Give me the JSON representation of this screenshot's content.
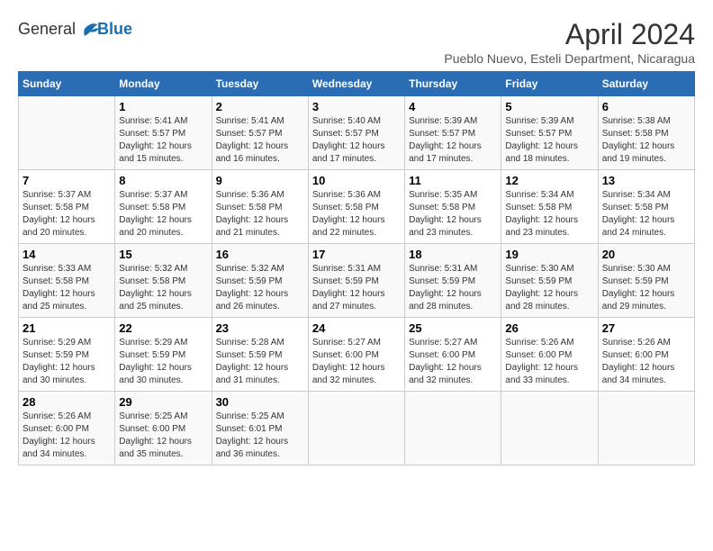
{
  "logo": {
    "text_general": "General",
    "text_blue": "Blue"
  },
  "title": "April 2024",
  "subtitle": "Pueblo Nuevo, Esteli Department, Nicaragua",
  "days_of_week": [
    "Sunday",
    "Monday",
    "Tuesday",
    "Wednesday",
    "Thursday",
    "Friday",
    "Saturday"
  ],
  "weeks": [
    [
      {
        "day": "",
        "info": ""
      },
      {
        "day": "1",
        "info": "Sunrise: 5:41 AM\nSunset: 5:57 PM\nDaylight: 12 hours\nand 15 minutes."
      },
      {
        "day": "2",
        "info": "Sunrise: 5:41 AM\nSunset: 5:57 PM\nDaylight: 12 hours\nand 16 minutes."
      },
      {
        "day": "3",
        "info": "Sunrise: 5:40 AM\nSunset: 5:57 PM\nDaylight: 12 hours\nand 17 minutes."
      },
      {
        "day": "4",
        "info": "Sunrise: 5:39 AM\nSunset: 5:57 PM\nDaylight: 12 hours\nand 17 minutes."
      },
      {
        "day": "5",
        "info": "Sunrise: 5:39 AM\nSunset: 5:57 PM\nDaylight: 12 hours\nand 18 minutes."
      },
      {
        "day": "6",
        "info": "Sunrise: 5:38 AM\nSunset: 5:58 PM\nDaylight: 12 hours\nand 19 minutes."
      }
    ],
    [
      {
        "day": "7",
        "info": "Sunrise: 5:37 AM\nSunset: 5:58 PM\nDaylight: 12 hours\nand 20 minutes."
      },
      {
        "day": "8",
        "info": "Sunrise: 5:37 AM\nSunset: 5:58 PM\nDaylight: 12 hours\nand 20 minutes."
      },
      {
        "day": "9",
        "info": "Sunrise: 5:36 AM\nSunset: 5:58 PM\nDaylight: 12 hours\nand 21 minutes."
      },
      {
        "day": "10",
        "info": "Sunrise: 5:36 AM\nSunset: 5:58 PM\nDaylight: 12 hours\nand 22 minutes."
      },
      {
        "day": "11",
        "info": "Sunrise: 5:35 AM\nSunset: 5:58 PM\nDaylight: 12 hours\nand 23 minutes."
      },
      {
        "day": "12",
        "info": "Sunrise: 5:34 AM\nSunset: 5:58 PM\nDaylight: 12 hours\nand 23 minutes."
      },
      {
        "day": "13",
        "info": "Sunrise: 5:34 AM\nSunset: 5:58 PM\nDaylight: 12 hours\nand 24 minutes."
      }
    ],
    [
      {
        "day": "14",
        "info": "Sunrise: 5:33 AM\nSunset: 5:58 PM\nDaylight: 12 hours\nand 25 minutes."
      },
      {
        "day": "15",
        "info": "Sunrise: 5:32 AM\nSunset: 5:58 PM\nDaylight: 12 hours\nand 25 minutes."
      },
      {
        "day": "16",
        "info": "Sunrise: 5:32 AM\nSunset: 5:59 PM\nDaylight: 12 hours\nand 26 minutes."
      },
      {
        "day": "17",
        "info": "Sunrise: 5:31 AM\nSunset: 5:59 PM\nDaylight: 12 hours\nand 27 minutes."
      },
      {
        "day": "18",
        "info": "Sunrise: 5:31 AM\nSunset: 5:59 PM\nDaylight: 12 hours\nand 28 minutes."
      },
      {
        "day": "19",
        "info": "Sunrise: 5:30 AM\nSunset: 5:59 PM\nDaylight: 12 hours\nand 28 minutes."
      },
      {
        "day": "20",
        "info": "Sunrise: 5:30 AM\nSunset: 5:59 PM\nDaylight: 12 hours\nand 29 minutes."
      }
    ],
    [
      {
        "day": "21",
        "info": "Sunrise: 5:29 AM\nSunset: 5:59 PM\nDaylight: 12 hours\nand 30 minutes."
      },
      {
        "day": "22",
        "info": "Sunrise: 5:29 AM\nSunset: 5:59 PM\nDaylight: 12 hours\nand 30 minutes."
      },
      {
        "day": "23",
        "info": "Sunrise: 5:28 AM\nSunset: 5:59 PM\nDaylight: 12 hours\nand 31 minutes."
      },
      {
        "day": "24",
        "info": "Sunrise: 5:27 AM\nSunset: 6:00 PM\nDaylight: 12 hours\nand 32 minutes."
      },
      {
        "day": "25",
        "info": "Sunrise: 5:27 AM\nSunset: 6:00 PM\nDaylight: 12 hours\nand 32 minutes."
      },
      {
        "day": "26",
        "info": "Sunrise: 5:26 AM\nSunset: 6:00 PM\nDaylight: 12 hours\nand 33 minutes."
      },
      {
        "day": "27",
        "info": "Sunrise: 5:26 AM\nSunset: 6:00 PM\nDaylight: 12 hours\nand 34 minutes."
      }
    ],
    [
      {
        "day": "28",
        "info": "Sunrise: 5:26 AM\nSunset: 6:00 PM\nDaylight: 12 hours\nand 34 minutes."
      },
      {
        "day": "29",
        "info": "Sunrise: 5:25 AM\nSunset: 6:00 PM\nDaylight: 12 hours\nand 35 minutes."
      },
      {
        "day": "30",
        "info": "Sunrise: 5:25 AM\nSunset: 6:01 PM\nDaylight: 12 hours\nand 36 minutes."
      },
      {
        "day": "",
        "info": ""
      },
      {
        "day": "",
        "info": ""
      },
      {
        "day": "",
        "info": ""
      },
      {
        "day": "",
        "info": ""
      }
    ]
  ]
}
